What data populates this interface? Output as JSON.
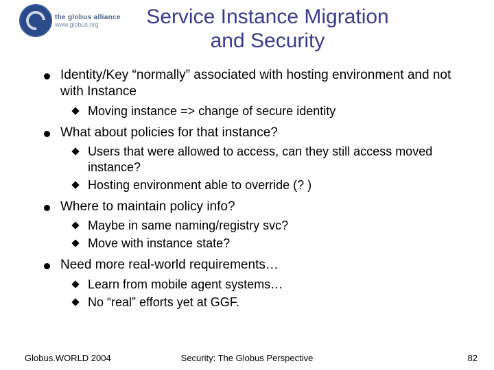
{
  "logo": {
    "alliance_text": "the globus alliance",
    "url_text": "www.globus.org"
  },
  "title_line1": "Service Instance Migration",
  "title_line2": "and Security",
  "bullets": [
    {
      "text": "Identity/Key “normally” associated with hosting environment and not with Instance",
      "sub": [
        "Moving instance => change of secure identity"
      ]
    },
    {
      "text": "What about policies for that instance?",
      "sub": [
        "Users that were allowed to access, can they still access moved instance?",
        "Hosting environment able to override (? )"
      ]
    },
    {
      "text": "Where to maintain policy info?",
      "sub": [
        "Maybe in same naming/registry svc?",
        "Move with instance state?"
      ]
    },
    {
      "text": "Need more real-world requirements…",
      "sub": [
        "Learn from mobile agent systems…",
        "No “real” efforts yet at GGF."
      ]
    }
  ],
  "footer": {
    "left": "Globus.WORLD 2004",
    "center": "Security: The Globus Perspective",
    "right": "82"
  }
}
